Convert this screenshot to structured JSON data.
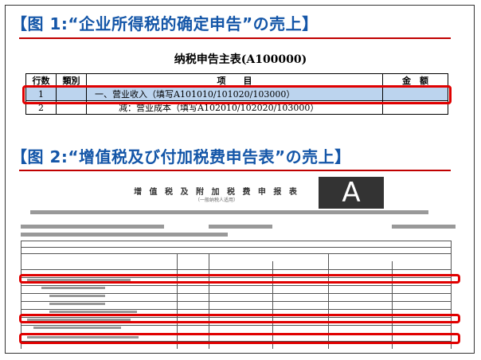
{
  "figure1": {
    "heading": "【图 1:“企业所得税的确定申告”の売上】",
    "table_title": "纳税申告主表(A100000)",
    "columns": [
      "行数",
      "類別",
      "项　　目",
      "金　额"
    ],
    "rows": [
      {
        "num": "1",
        "category": "",
        "item": "一、营业收入（填写A101010/101020/103000）",
        "amount": ""
      },
      {
        "num": "2",
        "category": "",
        "item": "减：营业成本（填写A102010/102020/103000）",
        "amount": ""
      }
    ]
  },
  "figure2": {
    "heading": "【图 2:“增值税及び付加税费申告表”の売上】",
    "form_title": "增 值 税 及 附 加 税 费 申 报 表",
    "form_subtitle": "（一般纳税人适用）",
    "watermark": "A"
  },
  "colors": {
    "heading": "#1456a8",
    "accent": "#c00000",
    "highlight": "#bcd4ee",
    "outline": "#e00000"
  }
}
